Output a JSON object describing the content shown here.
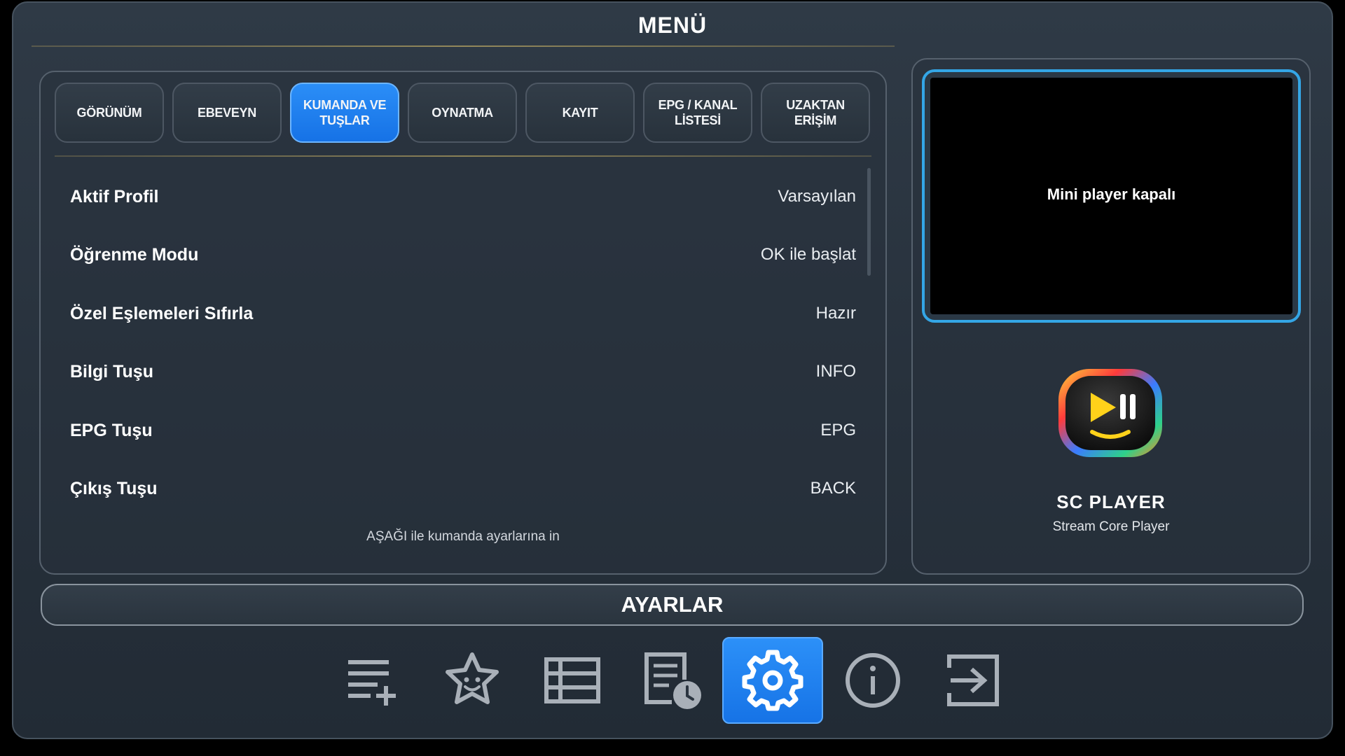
{
  "header": {
    "title": "MENÜ"
  },
  "tabs": [
    {
      "label": "GÖRÜNÜM",
      "active": false
    },
    {
      "label": "EBEVEYN",
      "active": false
    },
    {
      "label": "KUMANDA VE TUŞLAR",
      "active": true
    },
    {
      "label": "OYNATMA",
      "active": false
    },
    {
      "label": "KAYIT",
      "active": false
    },
    {
      "label": "EPG / KANAL LİSTESİ",
      "active": false
    },
    {
      "label": "UZAKTAN ERİŞİM",
      "active": false
    }
  ],
  "settings": [
    {
      "label": "Aktif Profil",
      "value": "Varsayılan"
    },
    {
      "label": "Öğrenme Modu",
      "value": "OK ile başlat"
    },
    {
      "label": "Özel Eşlemeleri Sıfırla",
      "value": "Hazır"
    },
    {
      "label": "Bilgi Tuşu",
      "value": "INFO"
    },
    {
      "label": "EPG Tuşu",
      "value": "EPG"
    },
    {
      "label": "Çıkış Tuşu",
      "value": "BACK"
    }
  ],
  "hint": "AŞAĞI ile kumanda ayarlarına in",
  "mini_player": {
    "text": "Mini player kapalı"
  },
  "app": {
    "name": "SC PLAYER",
    "subtitle": "Stream Core Player",
    "icon": "play-pause-logo-icon"
  },
  "section_bar": {
    "label": "AYARLAR"
  },
  "bottom_nav": [
    {
      "name": "add-playlist-icon",
      "active": false
    },
    {
      "name": "favorites-star-icon",
      "active": false
    },
    {
      "name": "list-grid-icon",
      "active": false
    },
    {
      "name": "epg-history-icon",
      "active": false
    },
    {
      "name": "settings-gear-icon",
      "active": true
    },
    {
      "name": "info-icon",
      "active": false
    },
    {
      "name": "exit-icon",
      "active": false
    }
  ],
  "colors": {
    "accent": "#1f82f0",
    "highlight_border": "#34a6e6",
    "background": "#2a343f"
  }
}
